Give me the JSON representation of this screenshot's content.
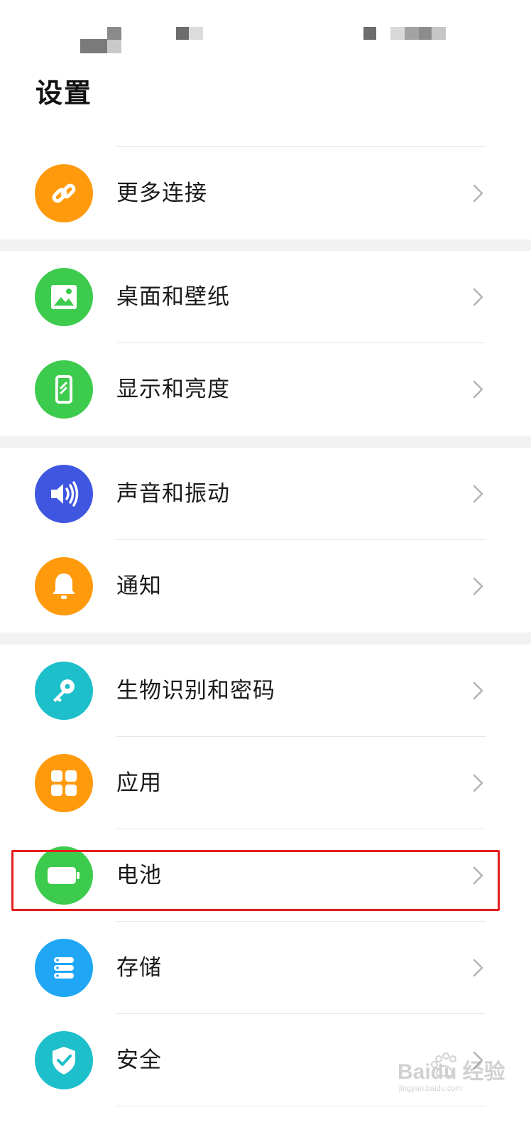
{
  "page": {
    "title": "设置"
  },
  "colors": {
    "orange": "#FF9A0D",
    "green": "#3DCB4E",
    "blue": "#3F56E0",
    "teal": "#1DBFCB",
    "sky": "#1FA6F5",
    "highlight": "#E51D1D",
    "group_gap": "#F2F2F2"
  },
  "settings": {
    "items": [
      {
        "label": "更多连接",
        "icon": "link-icon"
      },
      {
        "label": "桌面和壁纸",
        "icon": "image-icon"
      },
      {
        "label": "显示和亮度",
        "icon": "phone-screen-icon"
      },
      {
        "label": "声音和振动",
        "icon": "speaker-icon"
      },
      {
        "label": "通知",
        "icon": "bell-icon"
      },
      {
        "label": "生物识别和密码",
        "icon": "key-icon"
      },
      {
        "label": "应用",
        "icon": "apps-grid-icon"
      },
      {
        "label": "电池",
        "icon": "battery-icon",
        "highlighted": true
      },
      {
        "label": "存储",
        "icon": "storage-icon"
      },
      {
        "label": "安全",
        "icon": "shield-check-icon"
      }
    ]
  },
  "watermark": {
    "text": "Baidu 经验",
    "subtext": "jingyan.baidu.com"
  }
}
